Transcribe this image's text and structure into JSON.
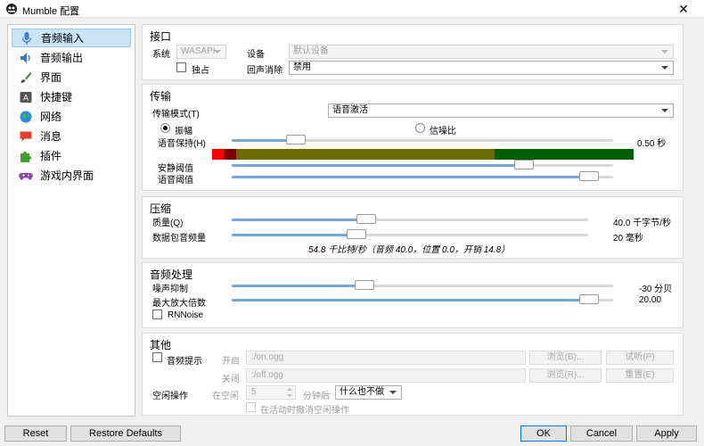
{
  "window": {
    "title": "Mumble 配置",
    "close_glyph": "✕"
  },
  "nav": {
    "items": [
      {
        "label": "音频输入",
        "icon": "microphone-icon",
        "selected": true
      },
      {
        "label": "音频输出",
        "icon": "speaker-icon",
        "selected": false
      },
      {
        "label": "界面",
        "icon": "paintbrush-icon",
        "selected": false
      },
      {
        "label": "快捷键",
        "icon": "keyboard-key-icon",
        "selected": false
      },
      {
        "label": "网络",
        "icon": "globe-icon",
        "selected": false
      },
      {
        "label": "消息",
        "icon": "chat-bubble-icon",
        "selected": false
      },
      {
        "label": "插件",
        "icon": "puzzle-piece-icon",
        "selected": false
      },
      {
        "label": "游戏内界面",
        "icon": "gamepad-icon",
        "selected": false
      }
    ]
  },
  "interface": {
    "title": "接口",
    "system_label": "系统",
    "system_value": "WASAPI",
    "device_label": "设备",
    "device_value": "默认设备",
    "exclusive_label": "独占",
    "echo_label": "回声消除",
    "echo_value": "禁用"
  },
  "transmission": {
    "title": "传输",
    "mode_label": "传输模式(T)",
    "mode_value": "语音激活",
    "radio_amplitude": "振幅",
    "radio_snr": "信噪比",
    "hold_label": "语音保持(H)",
    "hold_value": "0.50 秒",
    "hold_fraction": 0.15,
    "silence_label": "安静阈值",
    "silence_fraction": 0.78,
    "speech_label": "语音阈值",
    "speech_fraction": 0.96
  },
  "compression": {
    "title": "压缩",
    "quality_label": "质量(Q)",
    "quality_value": "40.0 千字节/秒",
    "quality_fraction": 0.37,
    "frames_label": "数据包音频量",
    "frames_value": "20 毫秒",
    "frames_fraction": 0.34,
    "summary": "54.8 千比特/秒（音频 40.0，位置 0.0，开销 14.8）"
  },
  "processing": {
    "title": "音频处理",
    "noise_label": "噪声抑制",
    "noise_value": "-30 分贝",
    "noise_fraction": 0.34,
    "amp_label": "最大放大倍数",
    "amp_value": "20.00",
    "amp_fraction": 0.96,
    "rnnoise_label": "RNNoise"
  },
  "misc": {
    "title": "其他",
    "cue_label": "音频提示",
    "on_label": "开启",
    "on_value": ":/on.ogg",
    "off_label": "关闭",
    "off_value": ":/off.ogg",
    "browse_on": "浏览(B)...",
    "browse_off": "浏览(R)...",
    "preview": "试听(P)",
    "reset": "重置(E)",
    "idle_label": "空闲操作",
    "idle_prefix": "在空闲",
    "idle_minutes": "5",
    "idle_suffix": "分钟后",
    "idle_action": "什么也不做",
    "idle_undo": "在活动时撤消空闲操作"
  },
  "buttons": {
    "reset": "Reset",
    "restore": "Restore Defaults",
    "ok": "OK",
    "cancel": "Cancel",
    "apply": "Apply"
  },
  "colors": {
    "accent": "#0078d7",
    "selection": "#cce4f7",
    "slider_fill": "#74a8d8",
    "vu_red": "#ff0000",
    "vu_darkred": "#7f0000",
    "vu_olive": "#6b6b00",
    "vu_green": "#005f00"
  }
}
